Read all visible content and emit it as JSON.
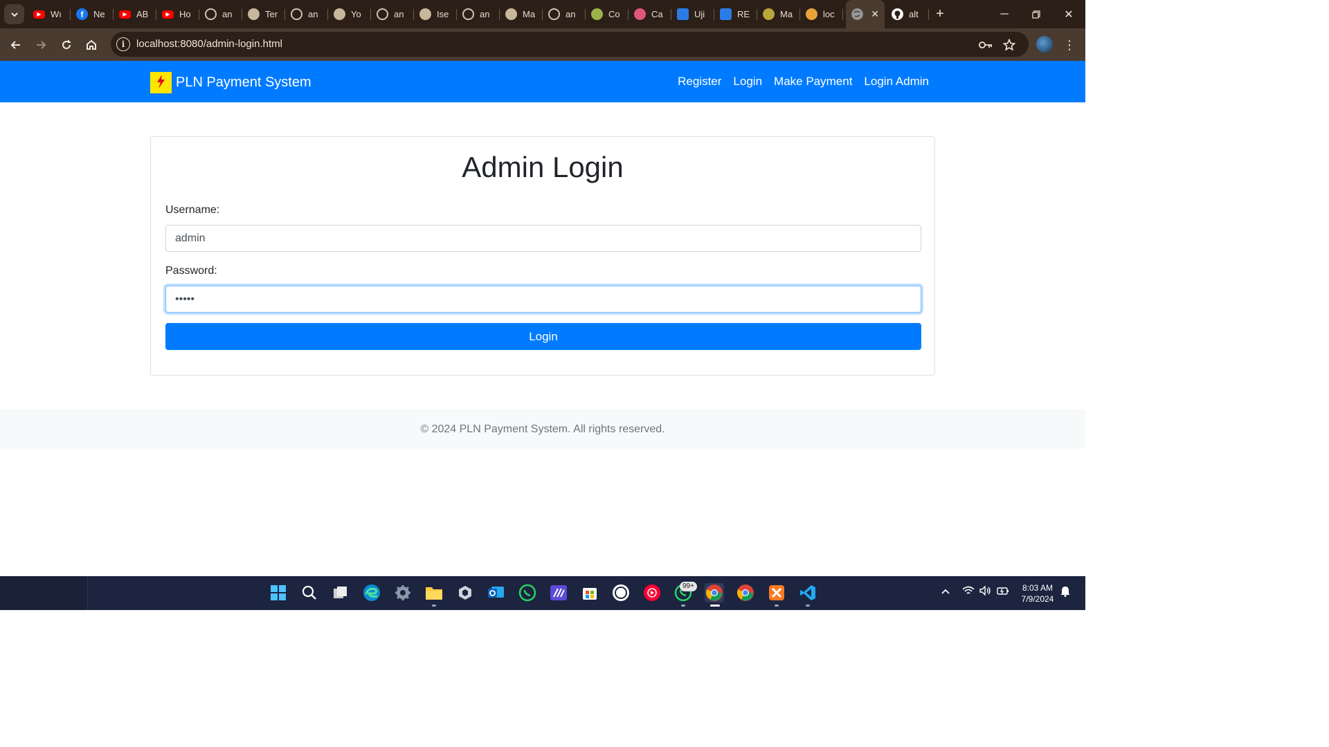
{
  "browser": {
    "tabs": [
      {
        "title": "Wı",
        "icon": "youtube-icon",
        "color": "#ff0000"
      },
      {
        "title": "Ne",
        "icon": "facebook-icon",
        "color": "#1877f2"
      },
      {
        "title": "AB",
        "icon": "youtube-icon",
        "color": "#ff0000"
      },
      {
        "title": "Ho",
        "icon": "youtube-icon",
        "color": "#ff0000"
      },
      {
        "title": "an",
        "icon": "globe-icon",
        "color": "#8a8a8a"
      },
      {
        "title": "Ter",
        "icon": "site-icon",
        "color": "#c9b79c"
      },
      {
        "title": "an",
        "icon": "globe-icon",
        "color": "#8a8a8a"
      },
      {
        "title": "Yo",
        "icon": "site-icon",
        "color": "#c9b79c"
      },
      {
        "title": "an",
        "icon": "globe-icon",
        "color": "#8a8a8a"
      },
      {
        "title": "Ise",
        "icon": "site-icon",
        "color": "#c9b79c"
      },
      {
        "title": "an",
        "icon": "globe-icon",
        "color": "#8a8a8a"
      },
      {
        "title": "Ma",
        "icon": "site-icon",
        "color": "#c9b79c"
      },
      {
        "title": "an",
        "icon": "globe-icon",
        "color": "#8a8a8a"
      },
      {
        "title": "Co",
        "icon": "site-icon",
        "color": "#9bb34a"
      },
      {
        "title": "Ca",
        "icon": "site-icon",
        "color": "#e0567a"
      },
      {
        "title": "Uji",
        "icon": "contact-icon",
        "color": "#2c7be5"
      },
      {
        "title": "RE",
        "icon": "contact-icon",
        "color": "#2c7be5"
      },
      {
        "title": "Ma",
        "icon": "site-icon",
        "color": "#b7a63a"
      },
      {
        "title": "loc",
        "icon": "site-icon",
        "color": "#e8a23a"
      }
    ],
    "active_tab": {
      "title": "",
      "icon": "globe-icon"
    },
    "next_tab": {
      "title": "alt",
      "icon": "github-icon"
    },
    "url": "localhost:8080/admin-login.html"
  },
  "site": {
    "brand": "PLN Payment System",
    "nav": [
      "Register",
      "Login",
      "Make Payment",
      "Login Admin"
    ]
  },
  "login": {
    "title": "Admin Login",
    "username_label": "Username:",
    "username_value": "admin",
    "password_label": "Password:",
    "password_value": "•••••",
    "button": "Login"
  },
  "footer": {
    "text": "© 2024 PLN Payment System. All rights reserved."
  },
  "taskbar": {
    "time": "8:03 AM",
    "date": "7/9/2024",
    "badge": "99+"
  },
  "colors": {
    "primary": "#007bff",
    "chrome_dark": "#2b1f17",
    "chrome_toolbar": "#4a3b30"
  }
}
